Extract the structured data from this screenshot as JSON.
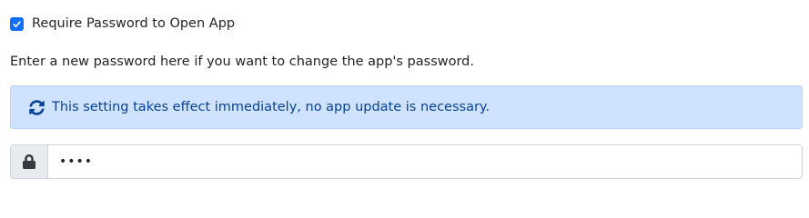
{
  "require_password": {
    "label": "Require Password to Open App",
    "checked": true
  },
  "help_text": "Enter a new password here if you want to change the app's password.",
  "alert": {
    "icon": "sync-icon",
    "text": "This setting takes effect immediately, no app update is necessary."
  },
  "password_field": {
    "icon": "lock-icon",
    "value": "••••",
    "type": "password"
  },
  "colors": {
    "accent": "#0d6efd",
    "alert_bg": "#cfe2ff",
    "alert_text": "#084298",
    "addon_bg": "#e9ecef"
  }
}
